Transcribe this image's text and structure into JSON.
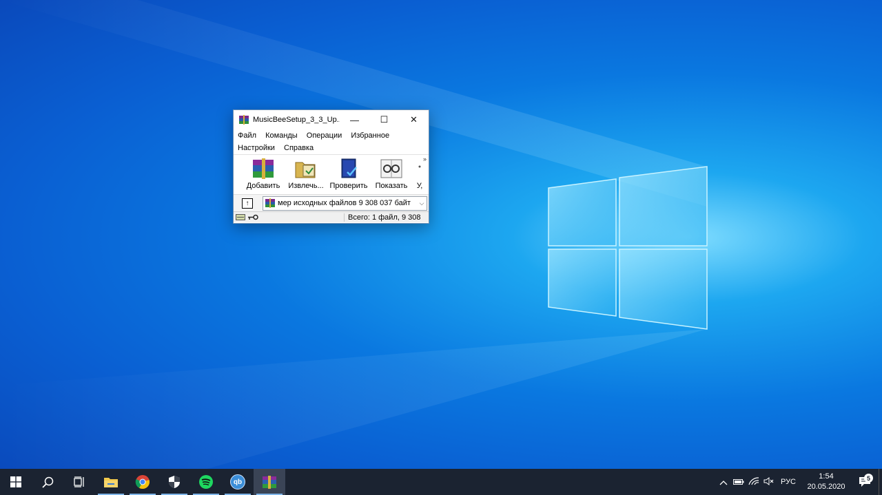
{
  "window": {
    "title": "MusicBeeSetup_3_3_Up...",
    "controls": {
      "minimize": "—",
      "maximize": "☐",
      "close": "✕"
    },
    "menu": [
      "Файл",
      "Команды",
      "Операции",
      "Избранное",
      "Настройки",
      "Справка"
    ],
    "toolbar": {
      "buttons": [
        {
          "label": "Добавить",
          "icon": "books-archive-icon"
        },
        {
          "label": "Извлечь...",
          "icon": "extract-folder-icon"
        },
        {
          "label": "Проверить",
          "icon": "test-book-icon"
        },
        {
          "label": "Показать",
          "icon": "view-glasses-icon"
        },
        {
          "label": "У,",
          "icon": "delete-icon"
        }
      ],
      "overflow": "»"
    },
    "address": {
      "up_symbol": "↑",
      "text": "мер исходных файлов 9 308 037 байт",
      "dropdown": "⌵"
    },
    "status": {
      "text": "Всего: 1 файл, 9 308"
    }
  },
  "taskbar": {
    "items": [
      {
        "name": "start-button",
        "icon": "windows-logo-icon"
      },
      {
        "name": "search-button",
        "icon": "search-icon"
      },
      {
        "name": "task-view-button",
        "icon": "task-view-icon"
      },
      {
        "name": "file-explorer-button",
        "icon": "folder-icon"
      },
      {
        "name": "chrome-button",
        "icon": "chrome-icon"
      },
      {
        "name": "security-button",
        "icon": "shield-icon"
      },
      {
        "name": "spotify-button",
        "icon": "spotify-icon"
      },
      {
        "name": "qbittorrent-button",
        "icon": "qbittorrent-icon",
        "text": "qb"
      },
      {
        "name": "winrar-button",
        "icon": "winrar-icon"
      }
    ],
    "tray": {
      "lang": "РУС",
      "time": "1:54",
      "date": "20.05.2020",
      "notifications": "5"
    }
  },
  "colors": {
    "taskbar": "#1b2331",
    "accent": "#7fb6ea",
    "wallpaper": "#0a78e0"
  }
}
